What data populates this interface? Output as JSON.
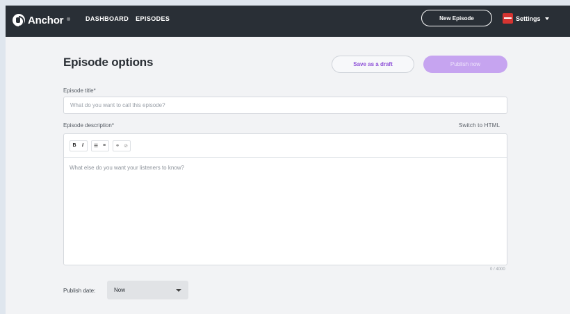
{
  "header": {
    "logo_text": "Anchor",
    "logo_reg": "®",
    "nav": [
      "DASHBOARD",
      "EPISODES"
    ],
    "new_episode_label": "New Episode",
    "settings_label": "Settings"
  },
  "page": {
    "title": "Episode options",
    "save_draft_label": "Save as a draft",
    "publish_now_label": "Publish now"
  },
  "form": {
    "title_label": "Episode title*",
    "title_placeholder": "What do you want to call this episode?",
    "description_label": "Episode description*",
    "switch_html_label": "Switch to HTML",
    "toolbar": {
      "bold": "B",
      "italic": "I",
      "bullet_list": "☰",
      "numbered_list": "≡",
      "link": "⚭",
      "unlink": "⊘"
    },
    "description_placeholder": "What else do you want your listeners to know?",
    "char_counter": "0 / 4000",
    "publish_date_label": "Publish date:",
    "publish_date_value": "Now"
  },
  "colors": {
    "header_bg": "#292f36",
    "accent_purple": "#8d4fd7",
    "publish_disabled": "#c6a4f0"
  }
}
